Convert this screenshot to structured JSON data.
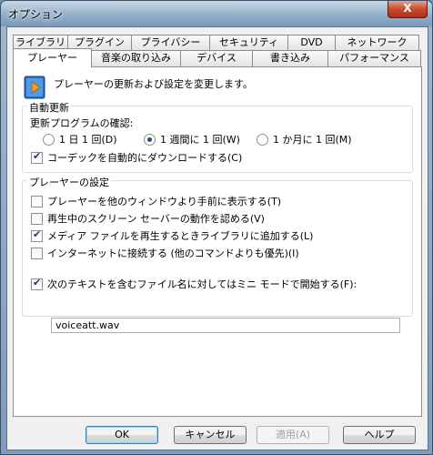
{
  "window": {
    "title": "オプション",
    "close_glyph": "X"
  },
  "tabs_back": [
    "ライブラリ",
    "プラグイン",
    "プライバシー",
    "セキュリティ",
    "DVD",
    "ネットワーク"
  ],
  "tabs_front": [
    "プレーヤー",
    "音楽の取り込み",
    "デバイス",
    "書き込み",
    "パフォーマンス"
  ],
  "active_tab": "プレーヤー",
  "intro_text": "プレーヤーの更新および設定を変更します。",
  "auto_update": {
    "group_label": "自動更新",
    "check_label": "更新プログラムの確認:",
    "options": [
      {
        "label": "1 日 1 回(D)",
        "selected": false
      },
      {
        "label": "1 週間に 1 回(W)",
        "selected": true
      },
      {
        "label": "1 か月に 1 回(M)",
        "selected": false
      }
    ],
    "codec_label": "コーデックを自動的にダウンロードする(C)",
    "codec_checked": true
  },
  "player_settings": {
    "group_label": "プレーヤーの設定",
    "items": [
      {
        "label": "プレーヤーを他のウィンドウより手前に表示する(T)",
        "checked": false
      },
      {
        "label": "再生中のスクリーン セーバーの動作を認める(V)",
        "checked": false
      },
      {
        "label": "メディア ファイルを再生するときライブラリに追加する(L)",
        "checked": true
      },
      {
        "label": "インターネットに接続する (他のコマンドよりも優先)(I)",
        "checked": false
      }
    ],
    "mini_mode_label": "次のテキストを含むファイル名に対してはミニ モードで開始する(F):",
    "mini_mode_checked": true,
    "mini_mode_value": "voiceatt.wav"
  },
  "buttons": {
    "ok": "OK",
    "cancel": "キャンセル",
    "apply": "適用(A)",
    "help": "ヘルプ"
  }
}
